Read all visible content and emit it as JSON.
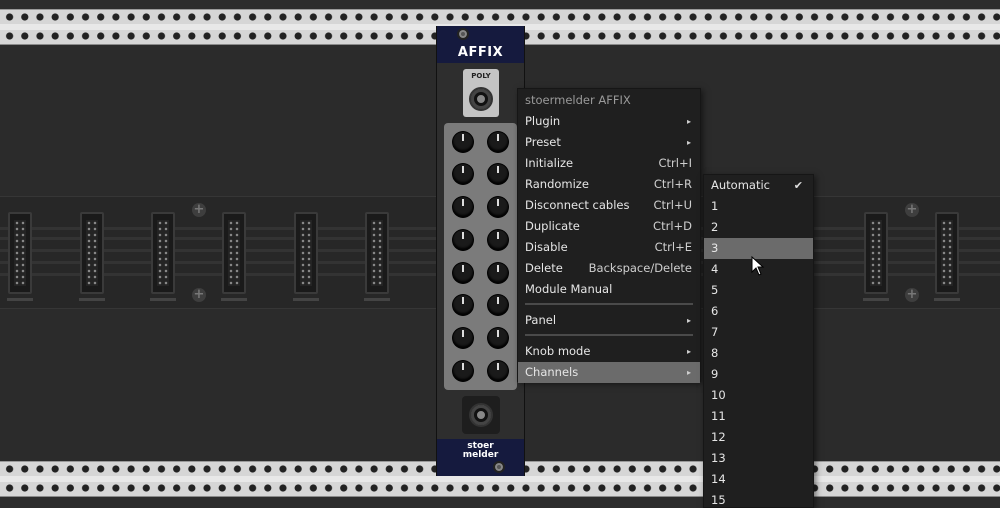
{
  "module": {
    "title": "AFFIX",
    "input_label": "POLY",
    "brand_line1": "stoer",
    "brand_line2": "melder"
  },
  "context_menu": {
    "header": "stoermelder AFFIX",
    "items": [
      {
        "label": "Plugin",
        "shortcut": "",
        "submenu": true
      },
      {
        "label": "Preset",
        "shortcut": "",
        "submenu": true
      },
      {
        "label": "Initialize",
        "shortcut": "Ctrl+I",
        "submenu": false
      },
      {
        "label": "Randomize",
        "shortcut": "Ctrl+R",
        "submenu": false
      },
      {
        "label": "Disconnect cables",
        "shortcut": "Ctrl+U",
        "submenu": false
      },
      {
        "label": "Duplicate",
        "shortcut": "Ctrl+D",
        "submenu": false
      },
      {
        "label": "Disable",
        "shortcut": "Ctrl+E",
        "submenu": false
      },
      {
        "label": "Delete",
        "shortcut": "Backspace/Delete",
        "submenu": false
      },
      {
        "label": "Module Manual",
        "shortcut": "",
        "submenu": false
      },
      {
        "label": "Panel",
        "shortcut": "",
        "submenu": true
      },
      {
        "label": "Knob mode",
        "shortcut": "",
        "submenu": true
      },
      {
        "label": "Channels",
        "shortcut": "",
        "submenu": true,
        "highlighted": true
      }
    ],
    "arrow": "▸"
  },
  "channels_submenu": {
    "items": [
      "Automatic",
      "1",
      "2",
      "3",
      "4",
      "5",
      "6",
      "7",
      "8",
      "9",
      "10",
      "11",
      "12",
      "13",
      "14",
      "15"
    ],
    "checked": "Automatic",
    "check_mark": "✔",
    "hovered": "3"
  },
  "colors": {
    "module_header": "#151a3e",
    "menu_bg": "#1f1f1f",
    "menu_highlight": "#6b6b6b",
    "rail": "#d6d6d6"
  }
}
